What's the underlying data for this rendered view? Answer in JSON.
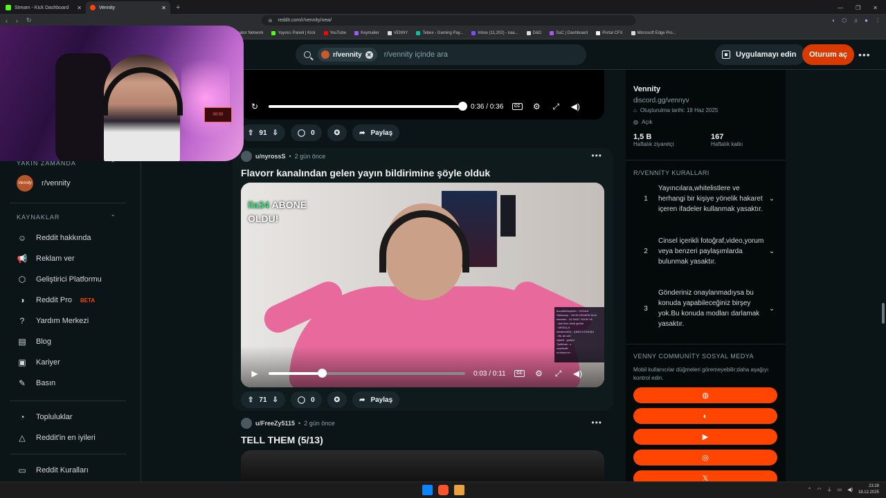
{
  "browser": {
    "tabs": [
      {
        "label": "Stream - Kick Dashboard",
        "active": false,
        "color": "#53fc18"
      },
      {
        "label": "Vennity",
        "active": true,
        "color": "#ff4500"
      }
    ],
    "url": "reddit.com/r/vennity/new/",
    "bookmarks": [
      {
        "label": "eator Network",
        "color": "#8ab4f8"
      },
      {
        "label": "Yayıncı Paneli | Kick",
        "color": "#53fc18"
      },
      {
        "label": "YouTube",
        "color": "#ff0000"
      },
      {
        "label": "Keymailer",
        "color": "#9b59ff"
      },
      {
        "label": "VENNY",
        "color": "#d7dadc"
      },
      {
        "label": "Tebex - Gaming Pay...",
        "color": "#00c2a8"
      },
      {
        "label": "Inbox (11,202) - kaa...",
        "color": "#7b4dff"
      },
      {
        "label": "D&D",
        "color": "#d7dadc"
      },
      {
        "label": "SaC | Dashboard",
        "color": "#a855f7"
      },
      {
        "label": "Portal CFX",
        "color": "#f5f5f5"
      },
      {
        "label": "Microsoft Edge Pro...",
        "color": "#d7dadc"
      }
    ]
  },
  "header": {
    "chip": "r/vennity",
    "search_placeholder": "r/vennity içinde ara",
    "app_button": "Uygulamayı edin",
    "login_button": "Oturum aç"
  },
  "leftnav": {
    "recent_title": "YAKIN ZAMANDA",
    "recent_sub": "r/vennity",
    "recent_avatar": "Vennity",
    "resources_title": "KAYNAKLAR",
    "items": [
      {
        "label": "Reddit hakkında",
        "icon": "reddit-icon"
      },
      {
        "label": "Reklam ver",
        "icon": "megaphone-icon"
      },
      {
        "label": "Geliştirici Platformu",
        "icon": "code-icon"
      },
      {
        "label": "Reddit Pro",
        "icon": "pro-icon",
        "badge": "BETA"
      },
      {
        "label": "Yardım Merkezi",
        "icon": "help-icon"
      },
      {
        "label": "Blog",
        "icon": "book-icon"
      },
      {
        "label": "Kariyer",
        "icon": "briefcase-icon"
      },
      {
        "label": "Basın",
        "icon": "microphone-icon"
      }
    ],
    "items2": [
      {
        "label": "Topluluklar",
        "icon": "communities-icon"
      },
      {
        "label": "Reddit'in en iyileri",
        "icon": "best-icon"
      }
    ],
    "items3": [
      {
        "label": "Reddit Kuralları",
        "icon": "rules-icon"
      }
    ]
  },
  "feed": {
    "top_video": {
      "time": "0:36 / 0:36",
      "progress": 1.0,
      "votes": "91",
      "comments": "0",
      "share": "Paylaş"
    },
    "post1": {
      "user": "u/nyrossS",
      "time": "2 gün önce",
      "title": "Flavorr kanalından gelen yayın bildirimine şöyle olduk",
      "overlay_line1": "lla34 ABONE",
      "overlay_line2": "OLDU!",
      "video_time": "0:03 / 0:11",
      "progress": 0.27,
      "votes": "71",
      "comments": "0",
      "share": "Paylaş",
      "chat_lines": [
        "bunaltilmisyerler : OHAAA",
        "Gkhanmy : YAYIN DEMENİ ALDI",
        "erkanhe : 24 SAAT YAYIN YA",
        "  : dan bize denk gelme",
        "  : SIFATA.H",
        "sinclemre24 : ŞİMDİ KONUŞA",
        "  : Biz de izle",
        "vijaniit : gidiyor",
        "7yelkhan : s",
        "ceyidasili : ",
        "ardakyerez : "
      ]
    },
    "post2": {
      "user": "u/FreeZy5115",
      "time": "2 gün önce",
      "title": "TELL THEM (5/13)"
    }
  },
  "sidebar": {
    "name": "Vennity",
    "link": "discord.gg/vennyv",
    "created": "Oluşturulma tarihi: 18 Haz 2025",
    "visibility": "Açık",
    "stats": [
      {
        "value": "1,5 B",
        "label": "Haftalık ziyaretçi"
      },
      {
        "value": "167",
        "label": "Haftalık katkı"
      }
    ],
    "rules_title": "R/VENNİTY KURALLARI",
    "rules": [
      {
        "n": "1",
        "text": "Yayıncılara,whitelistlere ve herhangi bir kişiye yönelik hakaret içeren ifadeler kullanmak yasaktır."
      },
      {
        "n": "2",
        "text": "Cinsel içerikli fotoğraf,video,yorum veya benzeri paylaşımlarda bulunmak yasaktır."
      },
      {
        "n": "3",
        "text": "Gönderiniz onaylanmadıysa bu konuda yapabileceğiniz birşey yok.Bu konuda modları darlamak yasaktır."
      }
    ],
    "social_title": "VENNY COMMUNİTY SOSYAL MEDYA",
    "social_desc": "Mobil kullanıcılar düğmeleri göremeyebilir;daha aşağıyı kontrol edin.",
    "social_buttons": [
      "globe-icon",
      "discord-icon",
      "youtube-icon",
      "instagram-icon",
      "x-icon"
    ]
  },
  "webcam": {
    "clock_text": "00:00"
  },
  "taskbar": {
    "time": "23:28",
    "date": "18.12.2025"
  },
  "colors": {
    "accent": "#ff4500",
    "login": "#d93a00",
    "bg": "#0b1416"
  }
}
